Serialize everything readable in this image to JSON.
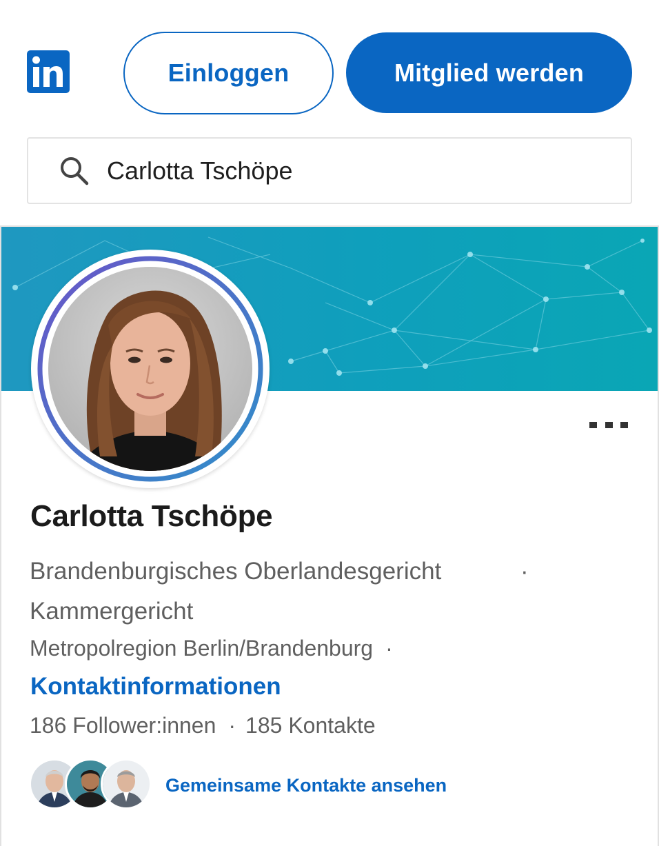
{
  "header": {
    "logo_text": "in",
    "login_label": "Einloggen",
    "join_label": "Mitglied werden"
  },
  "search": {
    "value": "Carlotta Tschöpe",
    "icon": "search-icon"
  },
  "profile": {
    "name": "Carlotta Tschöpe",
    "headline_line1": "Brandenburgisches Oberlandesgericht",
    "headline_separator": "·",
    "headline_line2": "Kammergericht",
    "location": "Metropolregion Berlin/Brandenburg",
    "location_separator": "·",
    "contact_info_label": "Kontaktinformationen",
    "followers": "186 Follower:innen",
    "stats_separator": "·",
    "connections": "185 Kontakte",
    "mutual_link_label": "Gemeinsame Kontakte ansehen"
  },
  "colors": {
    "brand": "#0a66c2",
    "banner": "#1aa0bd",
    "text_primary": "#1b1b1b",
    "text_secondary": "#5f5f5f"
  }
}
